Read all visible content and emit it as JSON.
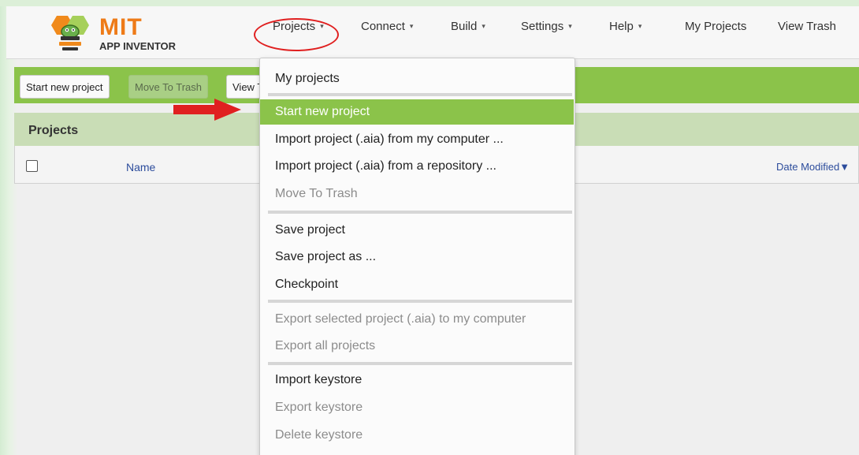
{
  "header": {
    "logo_title": "MIT",
    "logo_subtitle": "APP INVENTOR",
    "nav": [
      {
        "label": "Projects",
        "caret": "▾"
      },
      {
        "label": "Connect",
        "caret": "▾"
      },
      {
        "label": "Build",
        "caret": "▾"
      },
      {
        "label": "Settings",
        "caret": "▾"
      },
      {
        "label": "Help",
        "caret": "▾"
      },
      {
        "label": "My Projects"
      },
      {
        "label": "View Trash"
      }
    ]
  },
  "toolbar": {
    "start_new_project": "Start new project",
    "move_to_trash": "Move To Trash",
    "view": "View Trash"
  },
  "projects_panel": {
    "title": "Projects",
    "columns": {
      "name": "Name",
      "date_modified": "Date Modified▼"
    }
  },
  "projects_menu": {
    "items": [
      {
        "label": "My projects",
        "state": "enabled"
      },
      {
        "label": "Start new project",
        "state": "highlighted"
      },
      {
        "label": "Import project (.aia) from my computer ...",
        "state": "enabled"
      },
      {
        "label": "Import project (.aia) from a repository ...",
        "state": "enabled"
      },
      {
        "label": "Move To Trash",
        "state": "disabled"
      },
      {
        "label": "Save project",
        "state": "enabled"
      },
      {
        "label": "Save project as ...",
        "state": "enabled"
      },
      {
        "label": "Checkpoint",
        "state": "enabled"
      },
      {
        "label": "Export selected project (.aia) to my computer",
        "state": "disabled"
      },
      {
        "label": "Export all projects",
        "state": "disabled"
      },
      {
        "label": "Import keystore",
        "state": "enabled"
      },
      {
        "label": "Export keystore",
        "state": "disabled"
      },
      {
        "label": "Delete keystore",
        "state": "disabled"
      }
    ]
  },
  "colors": {
    "accent_green": "#8bc34a",
    "logo_orange": "#ee7b18",
    "annotation_red": "#e02020",
    "link_blue": "#2c4c9c"
  }
}
